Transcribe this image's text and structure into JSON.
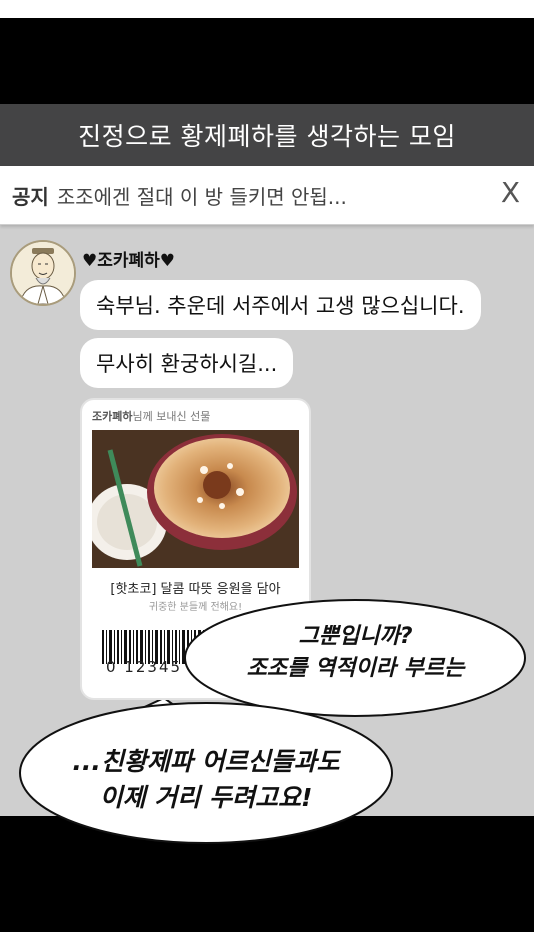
{
  "header": {
    "title": "진정으로 황제폐하를 생각하는 모임"
  },
  "notice": {
    "label": "공지",
    "text": "조조에겐 절대 이 방 들키면 안됩...",
    "close_glyph": "X"
  },
  "message": {
    "sender": "♥조카폐하♥",
    "bubbles": [
      "숙부님. 추운데 서주에서 고생 많으십니다.",
      "무사히 환궁하시길..."
    ]
  },
  "gift": {
    "sender_name": "조카폐하",
    "sender_suffix": "님께 보내신 선물",
    "title": "[핫초코] 달콤 따뜻 응원을 담아",
    "subtitle": "귀중한 분들께 전해요!",
    "barcode_number": "0 12345"
  },
  "speech": {
    "first": [
      "그뿐입니까?",
      "조조를 역적이라 부르는"
    ],
    "second": [
      "...친황제파 어르신들과도",
      "이제 거리 두려고요!"
    ]
  }
}
